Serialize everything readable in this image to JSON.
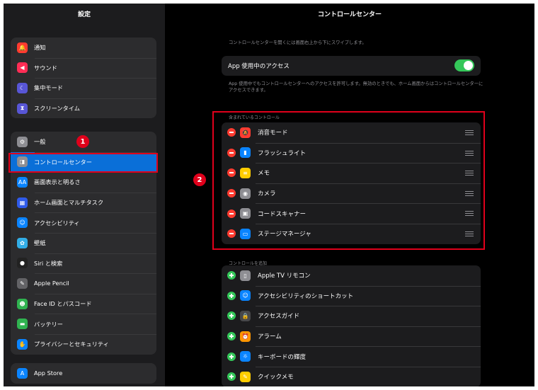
{
  "sidebar": {
    "title": "設定",
    "group1": [
      {
        "label": "通知",
        "icon": "bell-icon",
        "color": "#ff3b30",
        "glyph": "🔔"
      },
      {
        "label": "サウンド",
        "icon": "speaker-icon",
        "color": "#ff2d55",
        "glyph": "◀"
      },
      {
        "label": "集中モード",
        "icon": "moon-icon",
        "color": "#5856d6",
        "glyph": "☾"
      },
      {
        "label": "スクリーンタイム",
        "icon": "hourglass-icon",
        "color": "#5856d6",
        "glyph": "⧗"
      }
    ],
    "group2": [
      {
        "label": "一般",
        "icon": "gear-icon",
        "color": "#8e8e93",
        "glyph": "⚙"
      },
      {
        "label": "コントロールセンター",
        "icon": "toggles-icon",
        "color": "#8e8e93",
        "glyph": "◨",
        "selected": true
      },
      {
        "label": "画面表示と明るさ",
        "icon": "text-size-icon",
        "color": "#0a84ff",
        "glyph": "AA"
      },
      {
        "label": "ホーム画面とマルチタスク",
        "icon": "grid-icon",
        "color": "#2f5bea",
        "glyph": "▦"
      },
      {
        "label": "アクセシビリティ",
        "icon": "accessibility-icon",
        "color": "#0a84ff",
        "glyph": "☺"
      },
      {
        "label": "壁紙",
        "icon": "flower-icon",
        "color": "#32ade6",
        "glyph": "✿"
      },
      {
        "label": "Siri と検索",
        "icon": "siri-icon",
        "color": "#222222",
        "glyph": "●"
      },
      {
        "label": "Apple Pencil",
        "icon": "pencil-icon",
        "color": "#636366",
        "glyph": "✎"
      },
      {
        "label": "Face ID とパスコード",
        "icon": "face-id-icon",
        "color": "#30b350",
        "glyph": "☻"
      },
      {
        "label": "バッテリー",
        "icon": "battery-icon",
        "color": "#30b350",
        "glyph": "▬"
      },
      {
        "label": "プライバシーとセキュリティ",
        "icon": "hand-icon",
        "color": "#0a84ff",
        "glyph": "✋"
      }
    ],
    "group3": [
      {
        "label": "App Store",
        "icon": "app-store-icon",
        "color": "#0a84ff",
        "glyph": "A"
      }
    ]
  },
  "main": {
    "title": "コントロールセンター",
    "top_description": "コントロールセンターを開くには画面右上から下にスワイプします。",
    "access_label": "App 使用中のアクセス",
    "access_toggle_on": true,
    "access_description": "App 使用中でもコントロールセンターへのアクセスを許可します。無効のときでも、ホーム画面からはコントロールセンターにアクセスできます。",
    "included_label": "含まれているコントロール",
    "included": [
      {
        "label": "消音モード",
        "icon": "bell-slash-icon",
        "color": "#ff3b30",
        "glyph": "🔕"
      },
      {
        "label": "フラッシュライト",
        "icon": "flashlight-icon",
        "color": "#0a84ff",
        "glyph": "▮"
      },
      {
        "label": "メモ",
        "icon": "notes-icon",
        "color": "#ffcc00",
        "glyph": "≡"
      },
      {
        "label": "カメラ",
        "icon": "camera-icon",
        "color": "#8e8e93",
        "glyph": "◉"
      },
      {
        "label": "コードスキャナー",
        "icon": "qr-scanner-icon",
        "color": "#8e8e93",
        "glyph": "▣"
      },
      {
        "label": "ステージマネージャ",
        "icon": "stage-manager-icon",
        "color": "#0a84ff",
        "glyph": "▭"
      }
    ],
    "add_label": "コントロールを追加",
    "more": [
      {
        "label": "Apple TV リモコン",
        "icon": "remote-icon",
        "color": "#8e8e93",
        "glyph": "▯"
      },
      {
        "label": "アクセシビリティのショートカット",
        "icon": "accessibility-icon",
        "color": "#0a84ff",
        "glyph": "☺"
      },
      {
        "label": "アクセスガイド",
        "icon": "lock-icon",
        "color": "#48484a",
        "glyph": "🔒"
      },
      {
        "label": "アラーム",
        "icon": "alarm-icon",
        "color": "#ff9500",
        "glyph": "⏰"
      },
      {
        "label": "キーボードの輝度",
        "icon": "keyboard-brightness-icon",
        "color": "#0a84ff",
        "glyph": "☼"
      },
      {
        "label": "クイックメモ",
        "icon": "quick-note-icon",
        "color": "#ffcc00",
        "glyph": "✎"
      }
    ]
  },
  "annotations": {
    "badge1": "1",
    "badge2": "2",
    "highlight_color": "#e0001b"
  }
}
